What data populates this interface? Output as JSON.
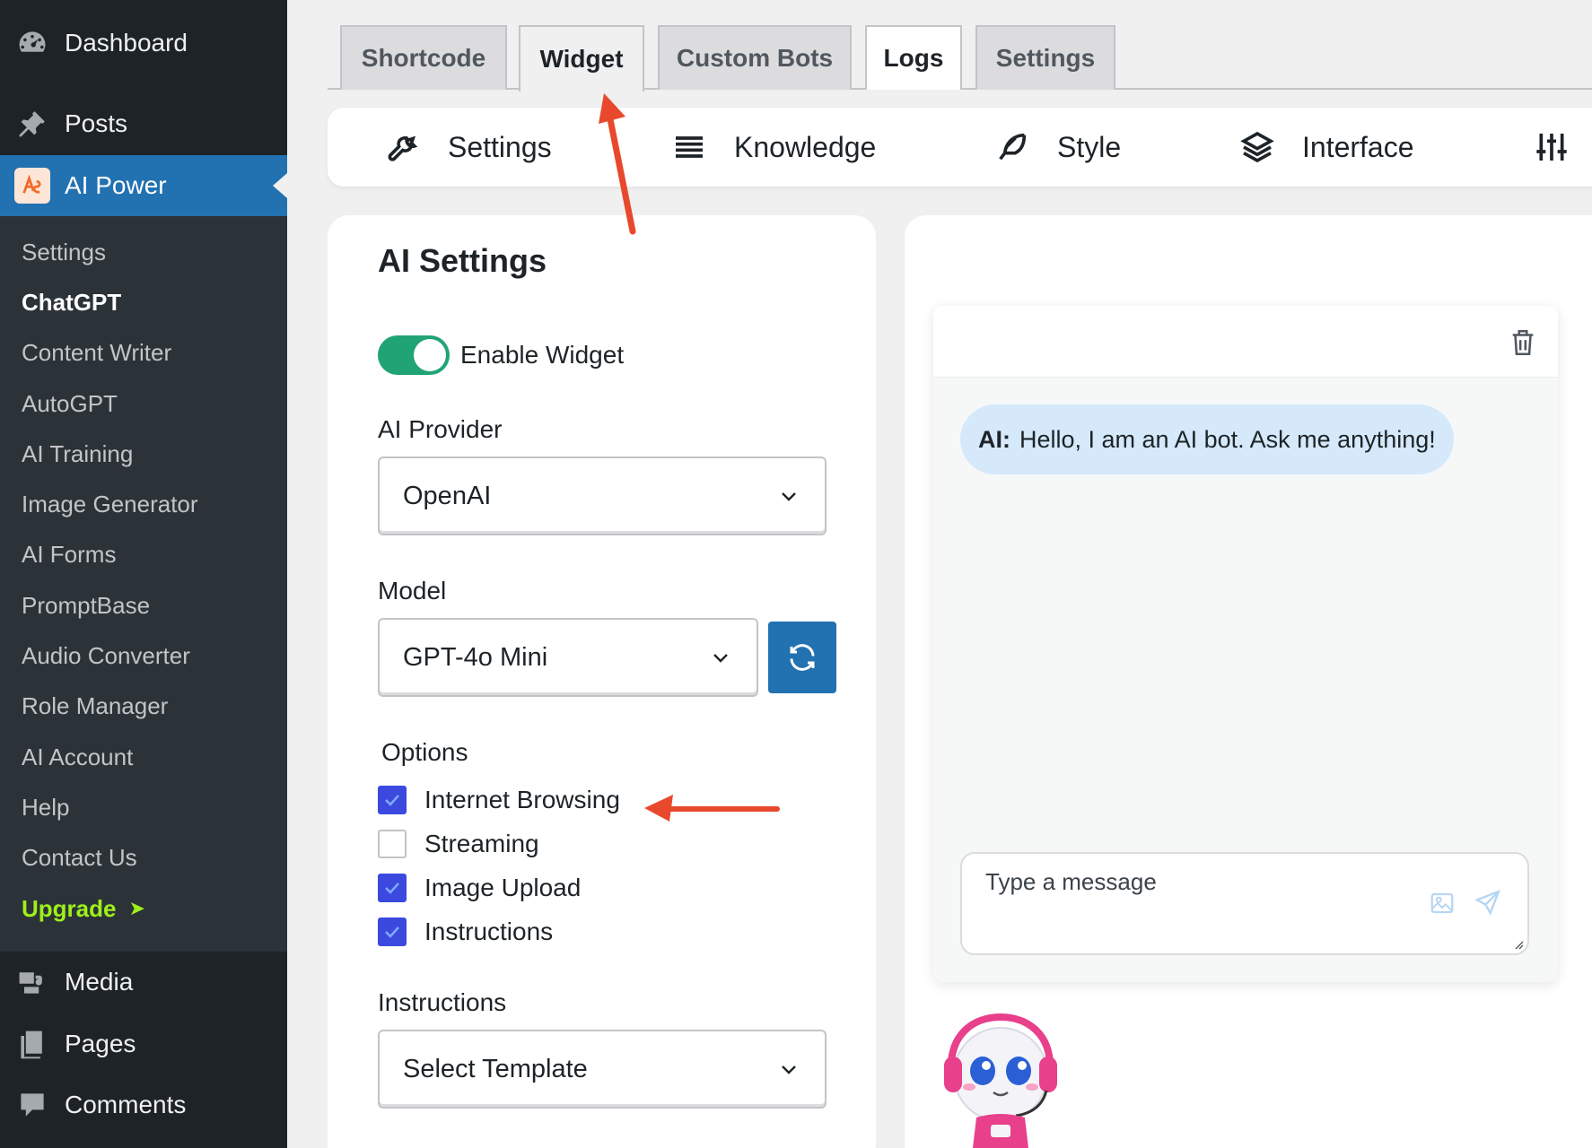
{
  "sidebar": {
    "top_items": [
      {
        "label": "Dashboard",
        "icon": "dashboard-icon"
      },
      {
        "label": "Posts",
        "icon": "pin-icon"
      },
      {
        "label": "AI Power",
        "icon": "ai-power-logo"
      }
    ],
    "submenu": [
      {
        "label": "Settings"
      },
      {
        "label": "ChatGPT",
        "current": true
      },
      {
        "label": "Content Writer"
      },
      {
        "label": "AutoGPT"
      },
      {
        "label": "AI Training"
      },
      {
        "label": "Image Generator"
      },
      {
        "label": "AI Forms"
      },
      {
        "label": "PromptBase"
      },
      {
        "label": "Audio Converter"
      },
      {
        "label": "Role Manager"
      },
      {
        "label": "AI Account"
      },
      {
        "label": "Help"
      },
      {
        "label": "Contact Us"
      },
      {
        "label": "Upgrade",
        "arrow": "➤"
      }
    ],
    "bottom_items": [
      {
        "label": "Media",
        "icon": "media-icon"
      },
      {
        "label": "Pages",
        "icon": "pages-icon"
      },
      {
        "label": "Comments",
        "icon": "comments-icon"
      }
    ]
  },
  "tabs": [
    {
      "label": "Shortcode"
    },
    {
      "label": "Widget",
      "active": true
    },
    {
      "label": "Custom Bots"
    },
    {
      "label": "Logs"
    },
    {
      "label": "Settings"
    }
  ],
  "subtabs": [
    {
      "label": "Settings",
      "icon": "wrench-icon"
    },
    {
      "label": "Knowledge",
      "icon": "lines-icon"
    },
    {
      "label": "Style",
      "icon": "feather-icon"
    },
    {
      "label": "Interface",
      "icon": "layers-icon"
    },
    {
      "label": "",
      "icon": "sliders-icon"
    }
  ],
  "ai_settings": {
    "title": "AI Settings",
    "enable_widget_label": "Enable Widget",
    "enable_widget_on": true,
    "provider_label": "AI Provider",
    "provider_value": "OpenAI",
    "model_label": "Model",
    "model_value": "GPT-4o Mini",
    "options_label": "Options",
    "options": [
      {
        "label": "Internet Browsing",
        "checked": true
      },
      {
        "label": "Streaming",
        "checked": false
      },
      {
        "label": "Image Upload",
        "checked": true
      },
      {
        "label": "Instructions",
        "checked": true
      }
    ],
    "instructions_label": "Instructions",
    "instructions_value": "Select Template"
  },
  "chat_preview": {
    "speaker": "AI:",
    "message": "Hello, I am an AI bot. Ask me anything!",
    "input_placeholder": "Type a message"
  },
  "colors": {
    "sidebar_bg": "#1d2327",
    "submenu_bg": "#2c3338",
    "accent_blue": "#2271b1",
    "toggle_green": "#20a474",
    "checkbox_blue": "#3b49df",
    "upgrade_green": "#9ef01a",
    "annotation_red": "#e8492d",
    "bubble_bg": "#d5e9fb"
  }
}
